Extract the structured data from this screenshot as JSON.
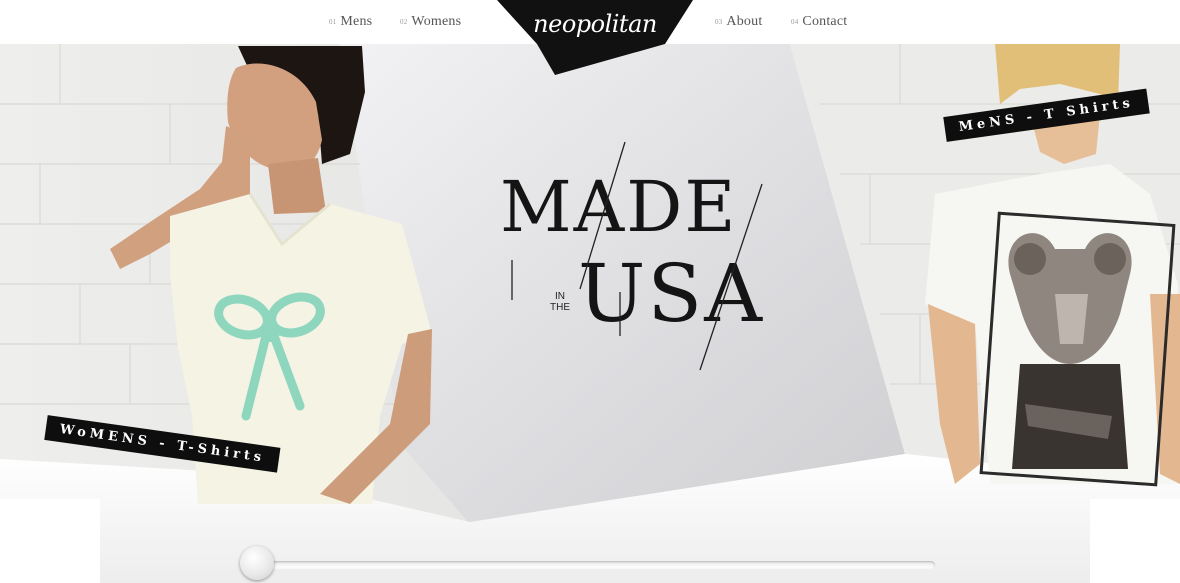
{
  "nav": {
    "items": [
      {
        "num": "01",
        "label": "Mens"
      },
      {
        "num": "02",
        "label": "Womens"
      },
      {
        "num": "03",
        "label": "About"
      },
      {
        "num": "04",
        "label": "Contact"
      }
    ],
    "logo": "neopolitan"
  },
  "hero": {
    "headline_top": "MADE",
    "headline_in": "IN",
    "headline_the": "THE",
    "headline_bottom": "USA",
    "womens_tag": "WoMENS - T-Shirts",
    "mens_tag": "MeNS - T Shirts"
  },
  "slider": {
    "position": 0
  },
  "colors": {
    "accent": "#111111",
    "rope": "#8fd6bf",
    "background": "#ffffff"
  }
}
